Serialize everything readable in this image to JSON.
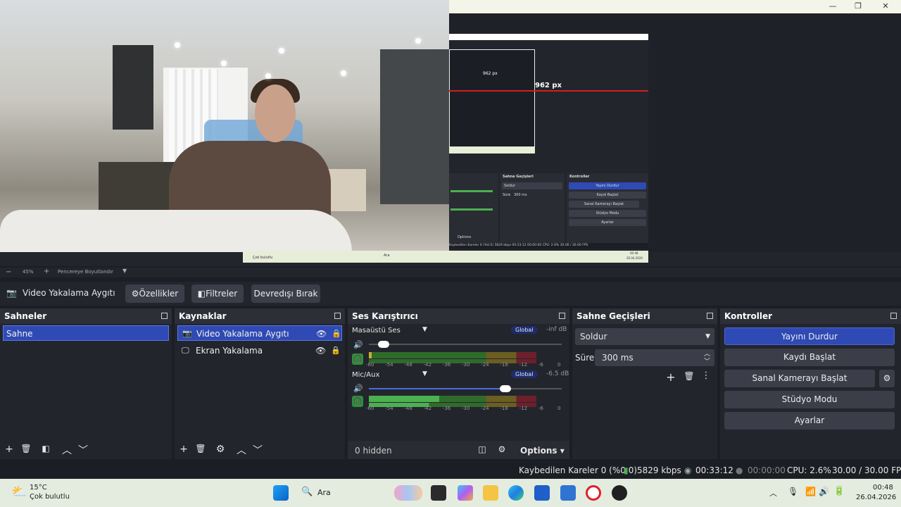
{
  "preview": {
    "inner_measure_large": "962 px",
    "inner_measure_small": "962 px",
    "inner_transitions_title": "Sahne Geçişleri",
    "inner_controls_title": "Kontroller",
    "inner_transition_value": "Soldur",
    "inner_duration_label": "Süre",
    "inner_duration_value": "300 ms",
    "inner_controls": [
      "Yayını Durdur",
      "Kaydı Başlat",
      "Sanal Kamerayı Başlat",
      "Stüdyo Modu",
      "Ayarlar"
    ],
    "inner_options": "Options",
    "inner_status": "Kaybedilen Kareler 0 (%0.0)   5829 kbps   00:33:12   00:00:00   CPU: 2.6%   30.00 / 30.00 FPS",
    "inner_taskbar_weather": "Çok bulutlu",
    "inner_taskbar_search": "Ara",
    "inner_taskbar_time": "00:48",
    "inner_taskbar_date": "26.04.2026",
    "zoom": "45%",
    "zoom_minus": "−",
    "zoom_plus": "+",
    "fit_label": "Pencereye Boyutlandır"
  },
  "source_toolbar": {
    "source_name": "Video Yakalama Aygıtı",
    "properties": "Özellikler",
    "filters": "Filtreler",
    "deactivate": "Devredışı Bırak"
  },
  "scenes": {
    "title": "Sahneler",
    "items": [
      "Sahne"
    ]
  },
  "sources": {
    "title": "Kaynaklar",
    "items": [
      "Video Yakalama Aygıtı",
      "Ekran Yakalama"
    ]
  },
  "mixer": {
    "title": "Ses Karıştırıcı",
    "channels": [
      {
        "name": "Masaüstü Ses",
        "badge": "Global",
        "db": "-inf dB",
        "volume": 0.05
      },
      {
        "name": "Mic/Aux",
        "badge": "Global",
        "db": "-6.5 dB",
        "volume": 0.72
      }
    ],
    "ticks": [
      "-60",
      "-54",
      "-48",
      "-42",
      "-36",
      "-30",
      "-24",
      "-18",
      "-12",
      "-6",
      "0"
    ],
    "hidden": "0 hidden",
    "options": "Options"
  },
  "transitions": {
    "title": "Sahne Geçişleri",
    "selected": "Soldur",
    "duration_label": "Süre",
    "duration_value": "300 ms"
  },
  "controls": {
    "title": "Kontroller",
    "stop_stream": "Yayını Durdur",
    "start_record": "Kaydı Başlat",
    "virtual_cam": "Sanal Kamerayı Başlat",
    "studio_mode": "Stüdyo Modu",
    "settings": "Ayarlar"
  },
  "status": {
    "dropped": "Kaybedilen Kareler 0 (%0.0)",
    "bitrate": "5829 kbps",
    "stream_time": "00:33:12",
    "record_time": "00:00:00",
    "cpu": "CPU: 2.6%",
    "fps": "30.00 / 30.00 FPS"
  },
  "taskbar": {
    "temp": "15°C",
    "weather": "Çok bulutlu",
    "search": "Ara",
    "time": "00:48",
    "date": "26.04.2026"
  },
  "colors": {
    "accent": "#2f4ab5",
    "meter_green": "#4caf50",
    "meter_yellow": "#c9b02e",
    "meter_red": "#b8263a"
  }
}
